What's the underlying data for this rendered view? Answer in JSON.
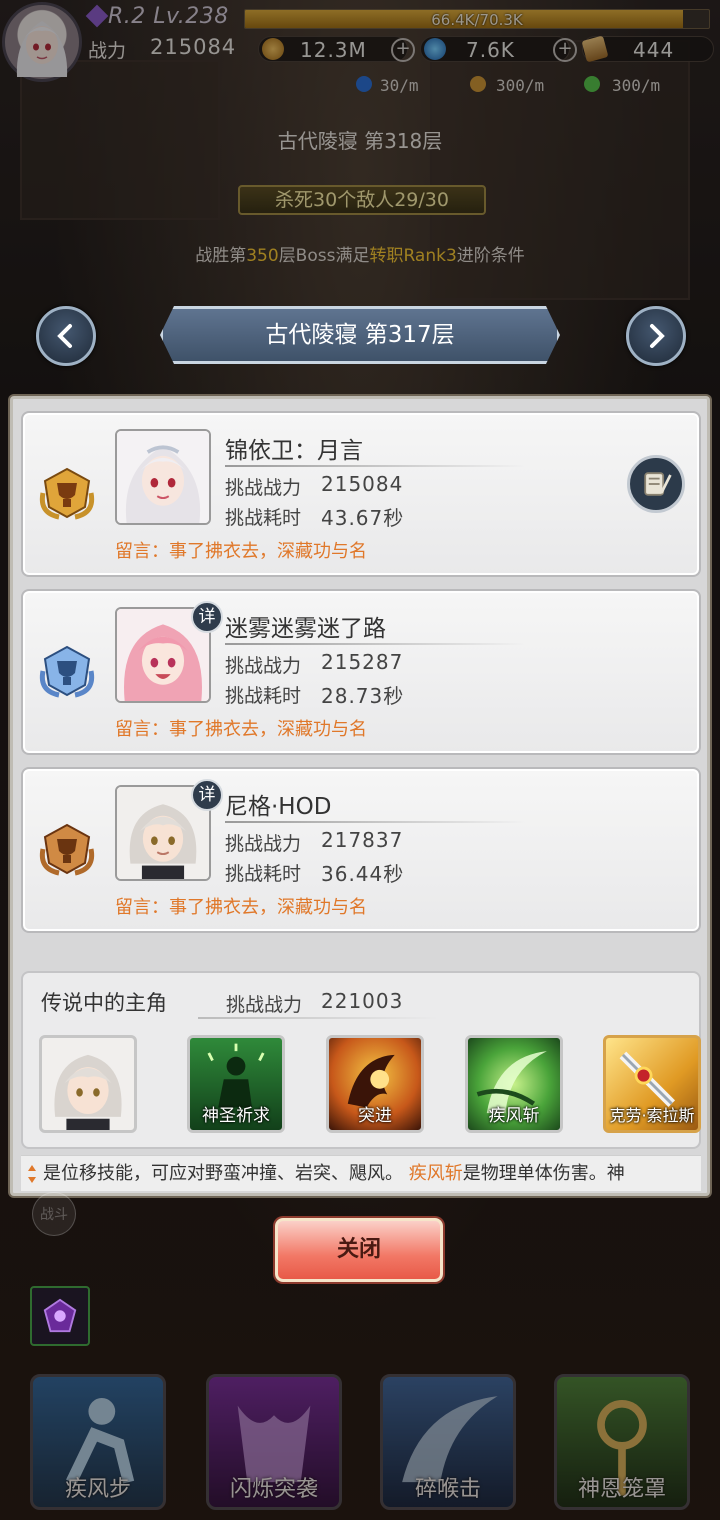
{
  "hud": {
    "level": "R.2 Lv.238",
    "exp_text": "66.4K/70.3K",
    "exp_progress": 0.944,
    "power_label": "战力",
    "power_value": "215084",
    "gold": "12.3M",
    "crystal": "7.6K",
    "scroll": "444",
    "rates": [
      "30/m",
      "300/m",
      "300/m"
    ]
  },
  "stage": {
    "title": "古代陵寝 第318层",
    "quest": "杀死30个敌人29/30",
    "boss_hint_parts": [
      "战胜第",
      "350",
      "层Boss满足",
      "转职Rank3",
      "进阶条件"
    ]
  },
  "floor_nav": {
    "title": "古代陵寝 第317层"
  },
  "records": [
    {
      "name": "锦依卫：月言",
      "has_detail": false,
      "rank": "gold",
      "power_label": "挑战战力",
      "power": "215084",
      "time_label": "挑战耗时",
      "time": "43.67秒",
      "message": "留言：事了拂衣去，深藏功与名"
    },
    {
      "name": "迷雾迷雾迷了路",
      "has_detail": true,
      "rank": "silver",
      "power_label": "挑战战力",
      "power": "215287",
      "time_label": "挑战耗时",
      "time": "28.73秒",
      "message": "留言：事了拂衣去，深藏功与名"
    },
    {
      "name": "尼格·HOD",
      "has_detail": true,
      "rank": "bronze",
      "power_label": "挑战战力",
      "power": "217837",
      "time_label": "挑战耗时",
      "time": "36.44秒",
      "message": "留言：事了拂衣去，深藏功与名"
    }
  ],
  "detail_badge": "详",
  "legend": {
    "title": "传说中的主角",
    "power_label": "挑战战力",
    "power": "221003",
    "skills": [
      "神圣祈求",
      "突进",
      "疾风斩",
      "克劳·索拉斯"
    ],
    "tip_parts": [
      "是位移技能，可应对野蛮冲撞、岩突、飓风。 ",
      "疾风斩",
      "是物理单体伤害。神"
    ]
  },
  "close_label": "关闭",
  "bottom": {
    "fight_label": "战斗",
    "skills": [
      "疾风步",
      "闪烁突袭",
      "碎喉击",
      "神恩笼罩"
    ]
  },
  "colors": {
    "accent_orange": "#e0782a",
    "highlight_yellow": "#f4c534",
    "panel_bg": "#d7d7d8"
  }
}
